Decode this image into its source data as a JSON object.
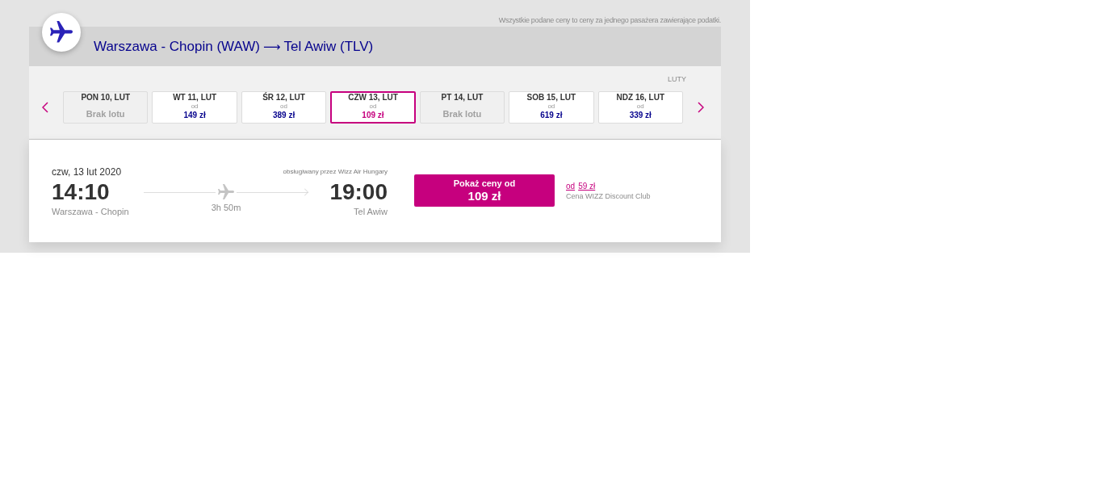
{
  "price_note": "Wszystkie podane ceny to ceny za jednego pasażera zawierające podatki.",
  "route": {
    "origin": "Warszawa - Chopin (WAW)",
    "arrow": "⟶",
    "destination": "Tel Awiw (TLV)"
  },
  "date_strip": {
    "month": "LUTY",
    "days": [
      {
        "label": "PON 10, LUT",
        "kind": "unavailable",
        "note": "Brak lotu",
        "selected": false
      },
      {
        "label": "WT 11, LUT",
        "kind": "price",
        "prefix": "od",
        "price": "149 zł",
        "selected": false
      },
      {
        "label": "ŚR 12, LUT",
        "kind": "price",
        "prefix": "od",
        "price": "389 zł",
        "selected": false
      },
      {
        "label": "CZW 13, LUT",
        "kind": "price",
        "prefix": "od",
        "price": "109 zł",
        "selected": true
      },
      {
        "label": "PT 14, LUT",
        "kind": "unavailable",
        "note": "Brak lotu",
        "selected": false
      },
      {
        "label": "SOB 15, LUT",
        "kind": "price",
        "prefix": "od",
        "price": "619 zł",
        "selected": false
      },
      {
        "label": "NDZ 16, LUT",
        "kind": "price",
        "prefix": "od",
        "price": "339 zł",
        "selected": false
      }
    ]
  },
  "flight": {
    "date": "czw, 13 lut 2020",
    "operator": "obsługiwany przez Wizz Air Hungary",
    "departure": {
      "time": "14:10",
      "airport": "Warszawa - Chopin"
    },
    "duration": "3h 50m",
    "arrival": {
      "time": "19:00",
      "airport": "Tel Awiw"
    },
    "price_button": {
      "label": "Pokaż ceny od",
      "price": "109 zł"
    },
    "discount": {
      "prefix": "od",
      "price": "59 zł",
      "label": "Cena WIZZ Discount Club"
    }
  }
}
